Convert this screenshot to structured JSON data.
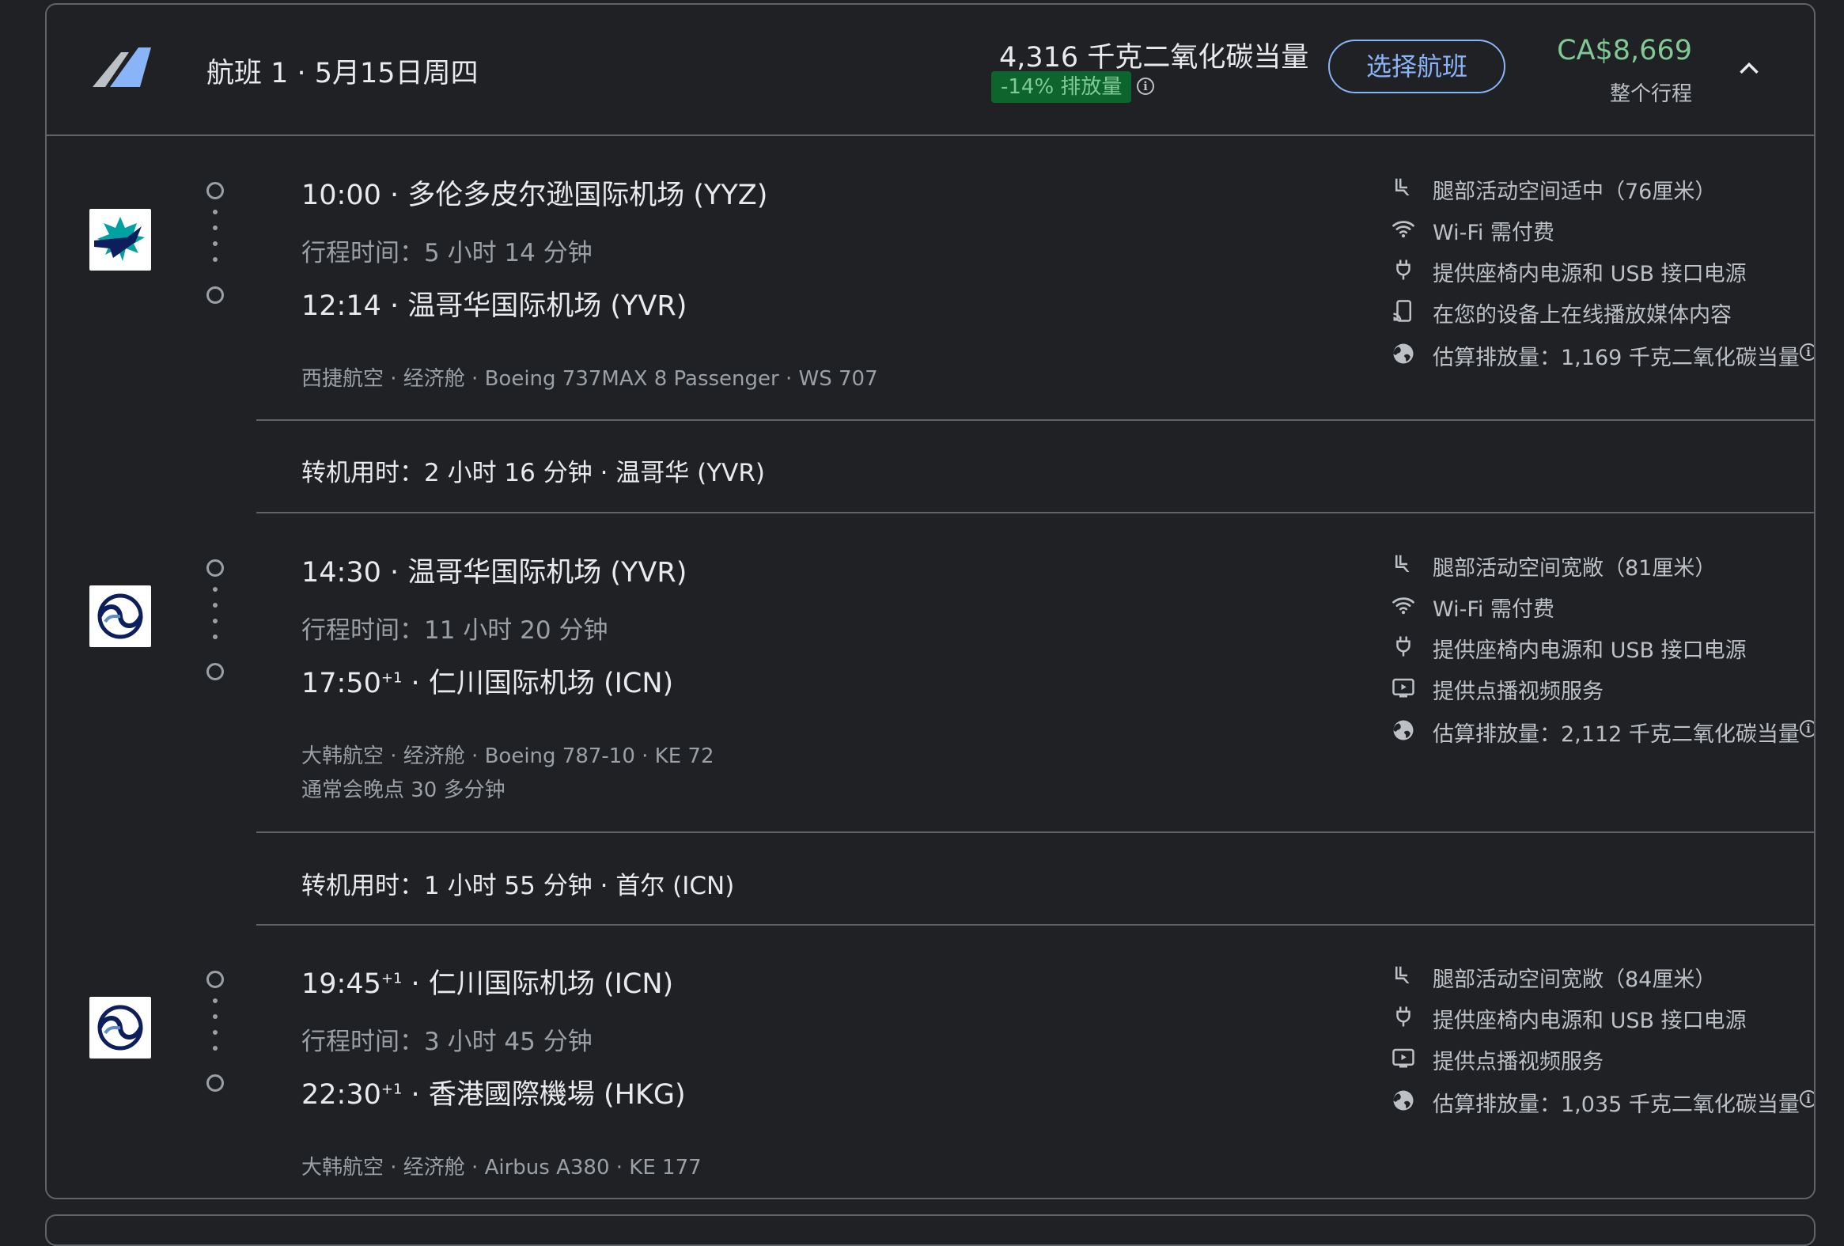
{
  "header": {
    "title": "航班 1 · 5月15日周四",
    "co2_total": "4,316 千克二氧化碳当量",
    "co2_badge": "-14% 排放量",
    "select_button": "选择航班",
    "price": "CA$8,669",
    "price_label": "整个行程"
  },
  "segments": [
    {
      "airline": "westjet",
      "depart_time": "10:00",
      "depart_sup": "",
      "depart_airport": "多伦多皮尔逊国际机场 (YYZ)",
      "duration": "行程时间：5 小时 14 分钟",
      "arrive_time": "12:14",
      "arrive_sup": "",
      "arrive_airport": "温哥华国际机场 (YVR)",
      "meta": "西捷航空 · 经济舱 · Boeing 737MAX 8 Passenger · WS 707",
      "note": "",
      "amenities": [
        {
          "icon": "legroom-icon",
          "text": "腿部活动空间适中（76厘米）"
        },
        {
          "icon": "wifi-icon",
          "text": "Wi-Fi 需付费"
        },
        {
          "icon": "power-plug-icon",
          "text": "提供座椅内电源和 USB 接口电源"
        },
        {
          "icon": "stream-media-icon",
          "text": "在您的设备上在线播放媒体内容"
        },
        {
          "icon": "globe-icon",
          "text": "估算排放量：1,169 千克二氧化碳当量"
        }
      ]
    },
    {
      "airline": "korean-air",
      "depart_time": "14:30",
      "depart_sup": "",
      "depart_airport": "温哥华国际机场 (YVR)",
      "duration": "行程时间：11 小时 20 分钟",
      "arrive_time": "17:50",
      "arrive_sup": "+1",
      "arrive_airport": "仁川国际机场 (ICN)",
      "meta": "大韩航空 · 经济舱 · Boeing 787-10 · KE 72",
      "note": "通常会晚点 30 多分钟",
      "amenities": [
        {
          "icon": "legroom-icon",
          "text": "腿部活动空间宽敞（81厘米）"
        },
        {
          "icon": "wifi-icon",
          "text": "Wi-Fi 需付费"
        },
        {
          "icon": "power-plug-icon",
          "text": "提供座椅内电源和 USB 接口电源"
        },
        {
          "icon": "video-on-demand-icon",
          "text": "提供点播视频服务"
        },
        {
          "icon": "globe-icon",
          "text": "估算排放量：2,112 千克二氧化碳当量"
        }
      ]
    },
    {
      "airline": "korean-air",
      "depart_time": "19:45",
      "depart_sup": "+1",
      "depart_airport": "仁川国际机场 (ICN)",
      "duration": "行程时间：3 小时 45 分钟",
      "arrive_time": "22:30",
      "arrive_sup": "+1",
      "arrive_airport": "香港國際機場 (HKG)",
      "meta": "大韩航空 · 经济舱 · Airbus A380 · KE 177",
      "note": "",
      "amenities": [
        {
          "icon": "legroom-icon",
          "text": "腿部活动空间宽敞（84厘米）"
        },
        {
          "icon": "power-plug-icon",
          "text": "提供座椅内电源和 USB 接口电源"
        },
        {
          "icon": "video-on-demand-icon",
          "text": "提供点播视频服务"
        },
        {
          "icon": "globe-icon",
          "text": "估算排放量：1,035 千克二氧化碳当量"
        }
      ]
    }
  ],
  "layovers": [
    "转机用时：2 小时 16 分钟 · 温哥华 (YVR)",
    "转机用时：1 小时 55 分钟 · 首尔 (ICN)"
  ],
  "colors": {
    "background": "#202124",
    "price_green": "#81c995",
    "badge_bg": "#0d652d",
    "accent_blue": "#8ab4f8",
    "westjet_teal": "#00a1a3",
    "korean_navy": "#0c1f5c"
  }
}
